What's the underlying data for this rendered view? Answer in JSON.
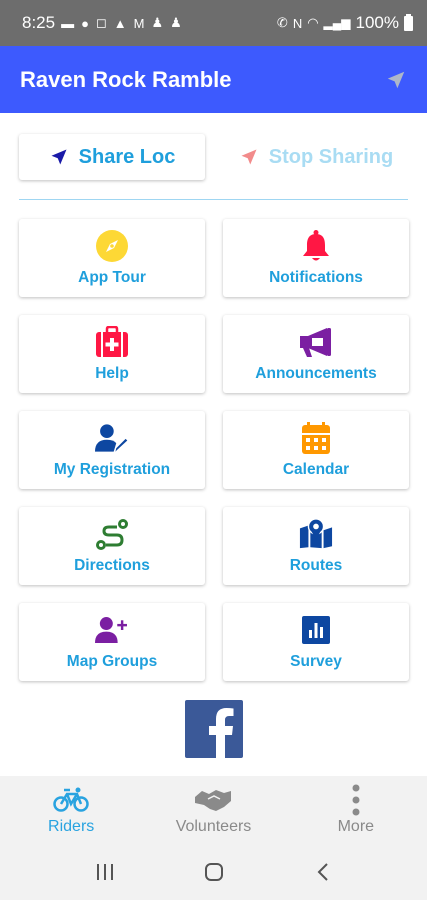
{
  "status_bar": {
    "time": "8:25",
    "battery": "100%"
  },
  "app_bar": {
    "title": "Raven Rock Ramble",
    "action_icon": "navigation-arrow-icon"
  },
  "location": {
    "share_label": "Share Loc",
    "stop_label": "Stop Sharing"
  },
  "tiles": [
    {
      "label": "App Tour",
      "icon": "compass-icon",
      "color": "#fdd835"
    },
    {
      "label": "Notifications",
      "icon": "bell-icon",
      "color": "#ff1744"
    },
    {
      "label": "Help",
      "icon": "first-aid-kit-icon",
      "color": "#ff1744"
    },
    {
      "label": "Announcements",
      "icon": "megaphone-icon",
      "color": "#7b1fa2"
    },
    {
      "label": "My Registration",
      "icon": "user-edit-icon",
      "color": "#0d47a1"
    },
    {
      "label": "Calendar",
      "icon": "calendar-icon",
      "color": "#ff9800"
    },
    {
      "label": "Directions",
      "icon": "route-icon",
      "color": "#2e7d32"
    },
    {
      "label": "Routes",
      "icon": "map-icon",
      "color": "#0d47a1"
    },
    {
      "label": "Map Groups",
      "icon": "user-plus-icon",
      "color": "#7b1fa2"
    },
    {
      "label": "Survey",
      "icon": "poll-icon",
      "color": "#0d47a1"
    }
  ],
  "bottom_nav": [
    {
      "label": "Riders",
      "icon": "bicycle-icon",
      "active": true
    },
    {
      "label": "Volunteers",
      "icon": "handshake-icon",
      "active": false
    },
    {
      "label": "More",
      "icon": "more-vertical-icon",
      "active": false
    }
  ],
  "colors": {
    "app_bar": "#3d5afe",
    "accent": "#1f9fdc",
    "facebook": "#3b5998"
  }
}
